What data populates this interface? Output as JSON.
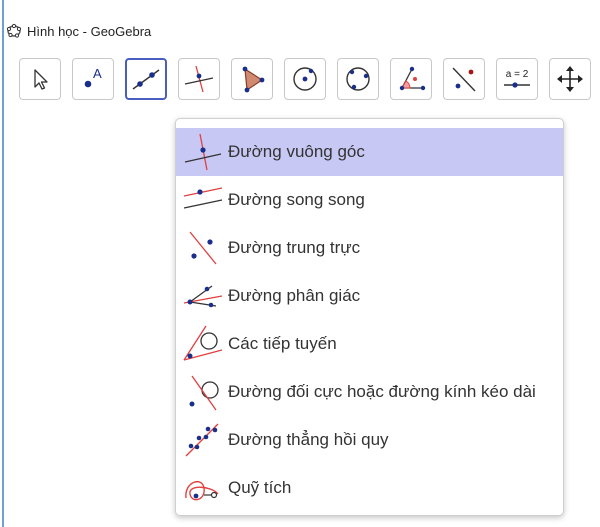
{
  "window": {
    "title": "Hình học - GeoGebra"
  },
  "toolbar": {
    "tools": [
      {
        "name": "move-tool",
        "icon": "cursor-arrow-icon"
      },
      {
        "name": "point-tool",
        "icon": "point-a-icon"
      },
      {
        "name": "line-tool",
        "icon": "line-through-points-icon",
        "active": true
      },
      {
        "name": "perpendicular-tool",
        "icon": "perpendicular-line-icon"
      },
      {
        "name": "polygon-tool",
        "icon": "polygon-icon"
      },
      {
        "name": "circle-center-tool",
        "icon": "circle-center-point-icon"
      },
      {
        "name": "circle-three-points-tool",
        "icon": "circle-three-points-icon"
      },
      {
        "name": "angle-tool",
        "icon": "angle-icon"
      },
      {
        "name": "reflect-tool",
        "icon": "reflect-line-icon"
      },
      {
        "name": "slider-tool",
        "icon": "slider-icon",
        "text": "a = 2"
      },
      {
        "name": "move-graphics-tool",
        "icon": "move-arrows-icon"
      }
    ]
  },
  "menu": {
    "items": [
      {
        "label": "Đường vuông góc",
        "icon": "perpendicular-line-icon",
        "selected": true
      },
      {
        "label": "Đường song song",
        "icon": "parallel-line-icon"
      },
      {
        "label": "Đường trung trực",
        "icon": "perpendicular-bisector-icon"
      },
      {
        "label": "Đường phân giác",
        "icon": "angle-bisector-icon"
      },
      {
        "label": "Các tiếp tuyến",
        "icon": "tangents-icon"
      },
      {
        "label": "Đường đối cực hoặc đường kính kéo dài",
        "icon": "polar-diameter-icon"
      },
      {
        "label": "Đường thẳng hồi quy",
        "icon": "best-fit-line-icon"
      },
      {
        "label": "Quỹ tích",
        "icon": "locus-icon"
      }
    ]
  },
  "colors": {
    "selected_bg": "#c8c8f5",
    "active_border": "#4a5ebf",
    "point": "#1a2f8a",
    "line_red": "#e04040"
  }
}
